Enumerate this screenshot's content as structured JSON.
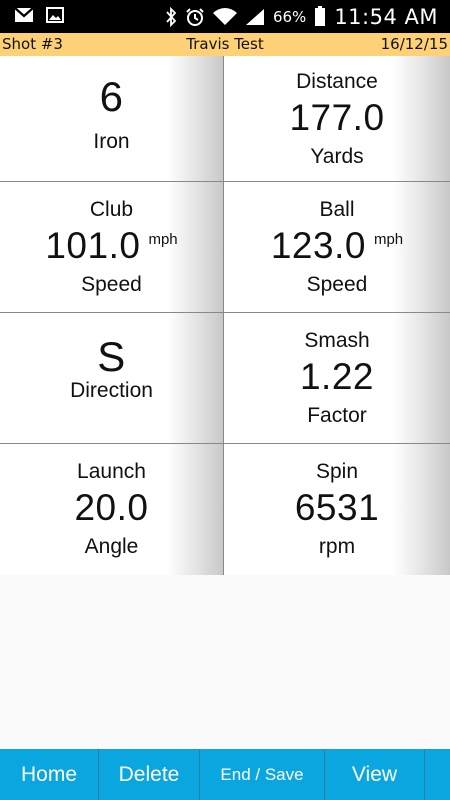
{
  "status": {
    "battery": "66%",
    "time": "11:54 AM"
  },
  "header": {
    "shot": "Shot #3",
    "title": "Travis Test",
    "date": "16/12/15"
  },
  "cells": [
    {
      "top": "",
      "value": "6",
      "unit": "",
      "bottom": "Iron"
    },
    {
      "top": "Distance",
      "value": "177.0",
      "unit": "",
      "bottom": "Yards"
    },
    {
      "top": "Club",
      "value": "101.0",
      "unit": "mph",
      "bottom": "Speed"
    },
    {
      "top": "Ball",
      "value": "123.0",
      "unit": "mph",
      "bottom": "Speed"
    },
    {
      "top": "",
      "value": "S",
      "unit": "",
      "bottom": "Direction"
    },
    {
      "top": "Smash",
      "value": "1.22",
      "unit": "",
      "bottom": "Factor"
    },
    {
      "top": "Launch",
      "value": "20.0",
      "unit": "",
      "bottom": "Angle"
    },
    {
      "top": "Spin",
      "value": "6531",
      "unit": "",
      "bottom": "rpm"
    }
  ],
  "buttons": {
    "home": "Home",
    "delete": "Delete",
    "end_save": "End / Save",
    "view": "View"
  }
}
